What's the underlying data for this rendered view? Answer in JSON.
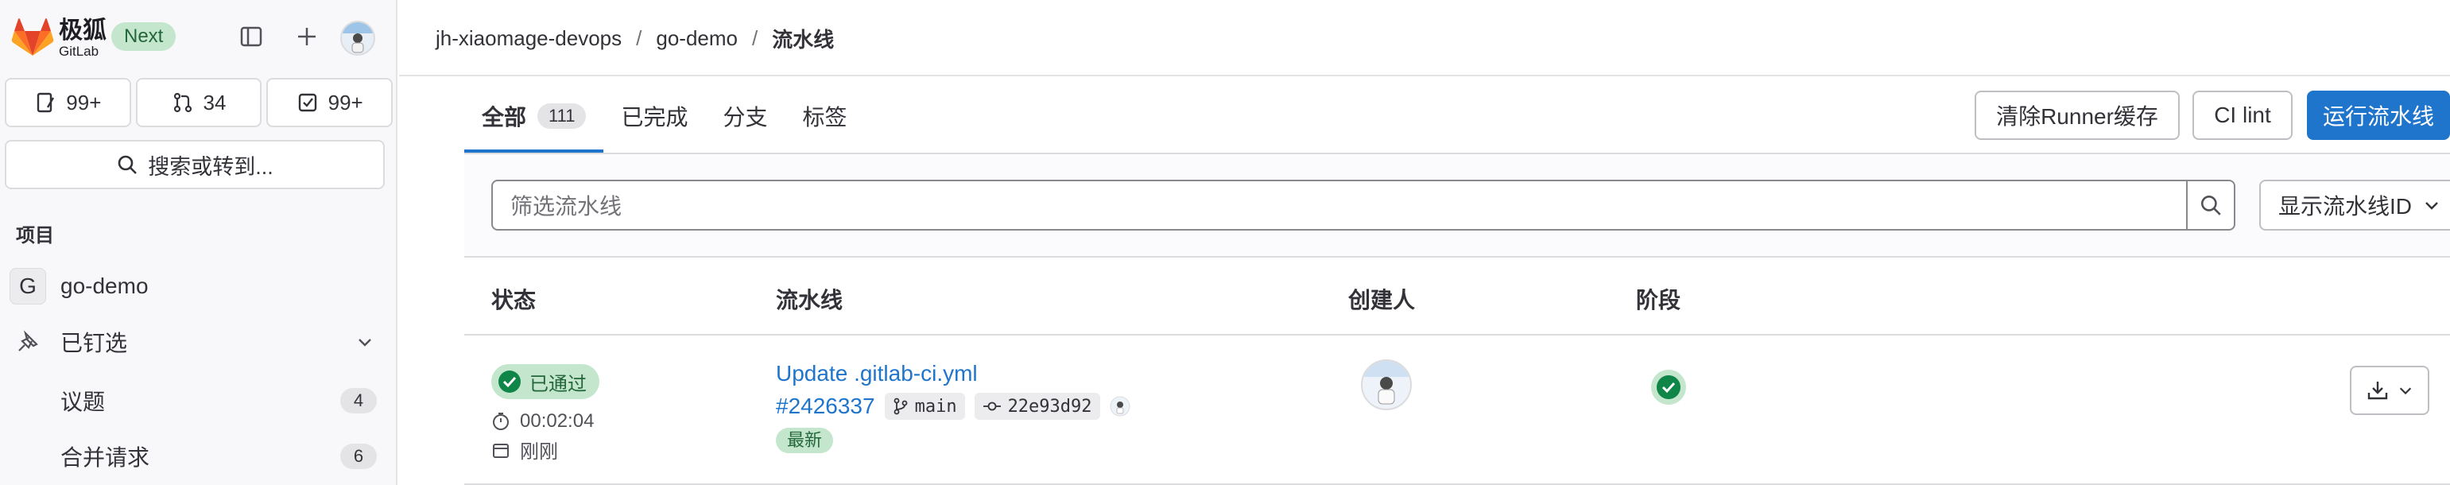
{
  "sidebar": {
    "brand_cn": "极狐",
    "brand_en": "GitLab",
    "next_badge": "Next",
    "counters": [
      {
        "icon": "issues-icon",
        "value": "99+"
      },
      {
        "icon": "merge-request-icon",
        "value": "34"
      },
      {
        "icon": "todo-icon",
        "value": "99+"
      }
    ],
    "search_label": "搜索或转到...",
    "section_label": "项目",
    "project": {
      "avatar_letter": "G",
      "name": "go-demo"
    },
    "pinned_label": "已钉选",
    "pinned_items": [
      {
        "label": "议题",
        "count": "4"
      },
      {
        "label": "合并请求",
        "count": "6"
      }
    ]
  },
  "breadcrumb": {
    "group": "jh-xiaomage-devops",
    "project": "go-demo",
    "current": "流水线"
  },
  "tabs": [
    {
      "label": "全部",
      "count": "111"
    },
    {
      "label": "已完成"
    },
    {
      "label": "分支"
    },
    {
      "label": "标签"
    }
  ],
  "actions": {
    "clear_cache": "清除Runner缓存",
    "ci_lint": "CI lint",
    "run_pipeline": "运行流水线"
  },
  "filter": {
    "placeholder": "筛选流水线",
    "id_select": "显示流水线ID"
  },
  "table": {
    "headers": {
      "status": "状态",
      "pipeline": "流水线",
      "creator": "创建人",
      "stages": "阶段"
    },
    "rows": [
      {
        "status": "已通过",
        "duration": "00:02:04",
        "finished": "刚刚",
        "title": "Update .gitlab-ci.yml",
        "id": "#2426337",
        "branch": "main",
        "commit": "22e93d92",
        "badge": "最新"
      }
    ]
  },
  "colors": {
    "primary": "#1f75cb",
    "success": "#108548",
    "success_bg": "#c3e6cd"
  }
}
